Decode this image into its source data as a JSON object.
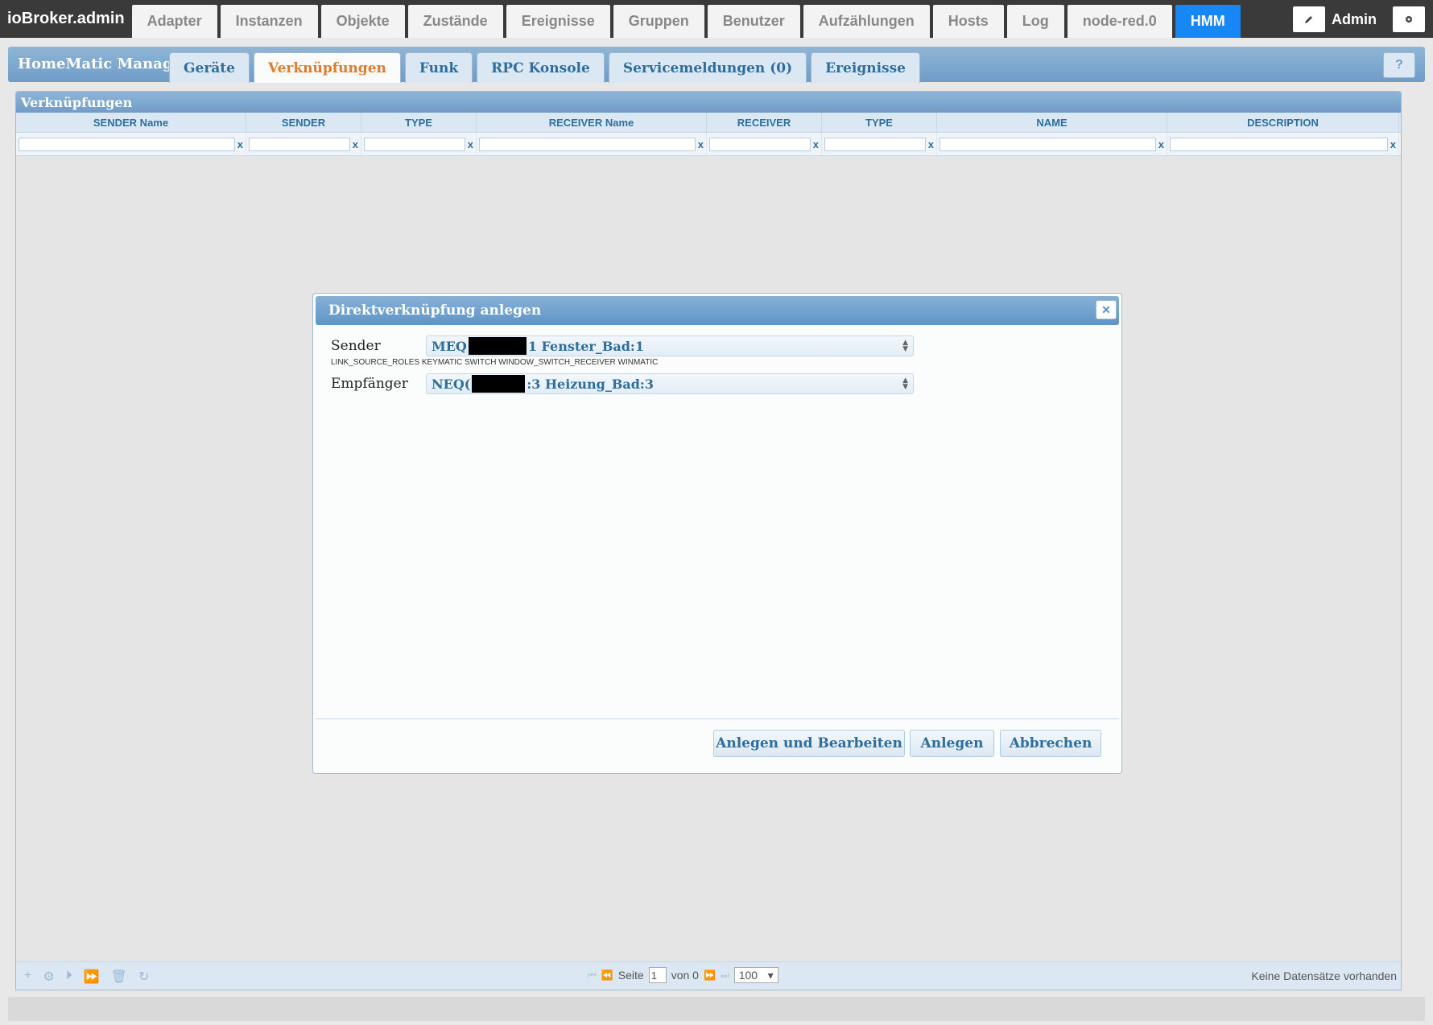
{
  "app": {
    "brand": "ioBroker.admin",
    "nav_tabs": [
      {
        "label": "Adapter"
      },
      {
        "label": "Instanzen"
      },
      {
        "label": "Objekte"
      },
      {
        "label": "Zustände"
      },
      {
        "label": "Ereignisse"
      },
      {
        "label": "Gruppen"
      },
      {
        "label": "Benutzer"
      },
      {
        "label": "Aufzählungen"
      },
      {
        "label": "Hosts"
      },
      {
        "label": "Log"
      },
      {
        "label": "node-red.0"
      },
      {
        "label": "HMM"
      }
    ],
    "active_nav": "HMM",
    "user_label": "Admin",
    "edit_icon": "pencil-icon",
    "settings_icon": "gear-icon",
    "accent_color": "#1787f5"
  },
  "hmm": {
    "title": "HomeMatic Manager",
    "tabs": [
      {
        "label": "Geräte"
      },
      {
        "label": "Verknüpfungen"
      },
      {
        "label": "Funk"
      },
      {
        "label": "RPC Konsole"
      },
      {
        "label": "Servicemeldungen (0)"
      },
      {
        "label": "Ereignisse"
      }
    ],
    "active_tab": "Verknüpfungen",
    "help_label": "?"
  },
  "grid": {
    "caption": "Verknüpfungen",
    "columns": [
      {
        "label": "SENDER Name"
      },
      {
        "label": "SENDER"
      },
      {
        "label": "TYPE"
      },
      {
        "label": "RECEIVER Name"
      },
      {
        "label": "RECEIVER"
      },
      {
        "label": "TYPE"
      },
      {
        "label": "NAME"
      },
      {
        "label": "DESCRIPTION"
      }
    ],
    "filter_clear": "x",
    "pager": {
      "page_label": "Seite",
      "page_value": "1",
      "of_label": "von 0",
      "rows_per_page": "100",
      "status": "Keine Datensätze vorhanden"
    }
  },
  "dialog": {
    "title": "Direktverknüpfung anlegen",
    "close_label": "✕",
    "sender_label": "Sender",
    "sender_prefix": "MEQ",
    "sender_suffix": "1 Fenster_Bad:1",
    "roles_text": "LINK_SOURCE_ROLES KEYMATIC SWITCH WINDOW_SWITCH_RECEIVER WINMATIC",
    "receiver_label": "Empfänger",
    "receiver_prefix": "NEQ(",
    "receiver_suffix": ":3 Heizung_Bad:3",
    "btn_create_edit": "Anlegen und Bearbeiten",
    "btn_create": "Anlegen",
    "btn_cancel": "Abbrechen"
  }
}
